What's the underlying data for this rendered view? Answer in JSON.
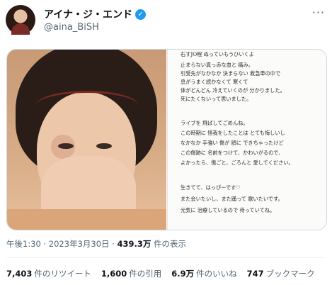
{
  "author": {
    "display_name": "アイナ・ジ・エンド",
    "handle": "@aina_BiSH",
    "verified_icon": "verified-badge-icon",
    "more_icon": "more-icon"
  },
  "letter_lines": [
    "石すJO程 ぬっていもうひいくよ",
    "止まらない真っ赤な血と 痛み。",
    "引受先がなかなか 決まらない 救急車の中で",
    "息がうまく続かなくて 寒くて",
    "体がどんどん 冷えていくのが 分かりました。",
    "死にたくないって思いました。",
    "",
    "ライブを 飛ばしてごめんね。",
    "この時期に 怪我をしたことは とても悔しいし",
    "なかなか 手強い 傷が 顔に できちゃったけど",
    "この傷跡に 名前をつけて、かわいがるので、",
    "よかったら、傷ごと、ごろんと 愛してください。",
    "",
    "生きてて、はっぴーです♡",
    "また会いたいし、また踊って 歌いたいです。",
    "元気に 治療しているので 待っていてね。"
  ],
  "tweet": {
    "time": "午後1:30",
    "separator": " · ",
    "date": "2023年3月30日",
    "views_count": "439.3万",
    "views_label": "件の表示"
  },
  "stats": [
    {
      "num": "7,403",
      "label": "件のリツイート"
    },
    {
      "num": "1,600",
      "label": "件の引用"
    },
    {
      "num": "6.9万",
      "label": "件のいいね"
    },
    {
      "num": "747",
      "label": "ブックマーク"
    }
  ]
}
